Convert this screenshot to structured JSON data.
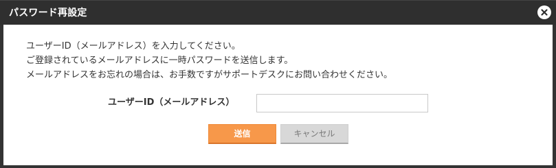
{
  "dialog": {
    "title": "パスワード再設定",
    "close_icon": "close-icon"
  },
  "message": {
    "lines": [
      "ユーザーID（メールアドレス）を入力してください。",
      "ご登録されているメールアドレスに一時パスワードを送信します。",
      "メールアドレスをお忘れの場合は、お手数ですがサポートデスクにお問い合わせください。"
    ]
  },
  "form": {
    "user_id_label": "ユーザーID（メールアドレス）",
    "user_id_value": "",
    "user_id_placeholder": ""
  },
  "buttons": {
    "send_label": "送信",
    "cancel_label": "キャンセル"
  },
  "colors": {
    "titlebar": "#2f2f2f",
    "send_button": "#f7984a",
    "cancel_button": "#d8d8d8"
  }
}
